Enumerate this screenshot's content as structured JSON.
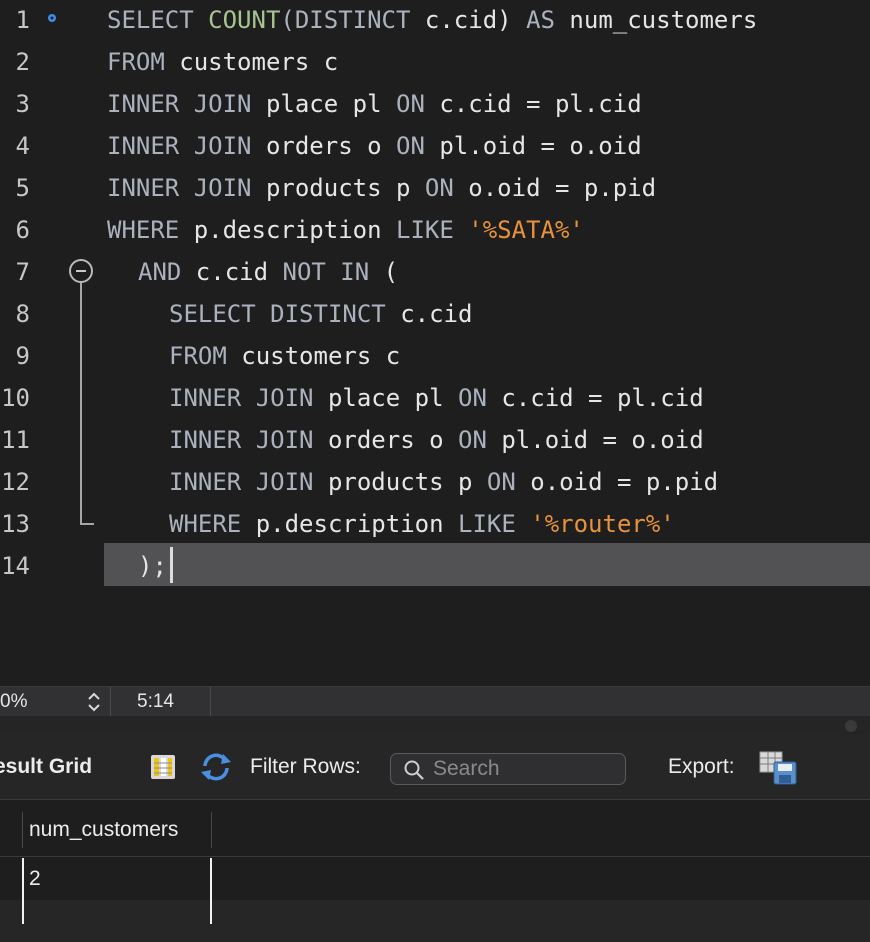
{
  "editor": {
    "colors": {
      "keyword": "#aab2bd",
      "function": "#a7c68f",
      "string": "#e8923c",
      "plain": "#e6e6e6"
    },
    "lines": [
      {
        "num": "1",
        "indent": 0,
        "tokens": [
          {
            "t": "SELECT ",
            "c": "keyword"
          },
          {
            "t": "COUNT",
            "c": "function"
          },
          {
            "t": "(DISTINCT ",
            "c": "keyword"
          },
          {
            "t": "c.cid) ",
            "c": "plain"
          },
          {
            "t": "AS ",
            "c": "keyword"
          },
          {
            "t": "num_customers",
            "c": "plain"
          }
        ]
      },
      {
        "num": "2",
        "indent": 0,
        "tokens": [
          {
            "t": "FROM ",
            "c": "keyword"
          },
          {
            "t": "customers c",
            "c": "plain"
          }
        ]
      },
      {
        "num": "3",
        "indent": 0,
        "tokens": [
          {
            "t": "INNER JOIN ",
            "c": "keyword"
          },
          {
            "t": "place pl ",
            "c": "plain"
          },
          {
            "t": "ON ",
            "c": "keyword"
          },
          {
            "t": "c.cid = pl.cid",
            "c": "plain"
          }
        ]
      },
      {
        "num": "4",
        "indent": 0,
        "tokens": [
          {
            "t": "INNER JOIN ",
            "c": "keyword"
          },
          {
            "t": "orders o ",
            "c": "plain"
          },
          {
            "t": "ON ",
            "c": "keyword"
          },
          {
            "t": "pl.oid = o.oid",
            "c": "plain"
          }
        ]
      },
      {
        "num": "5",
        "indent": 0,
        "tokens": [
          {
            "t": "INNER JOIN ",
            "c": "keyword"
          },
          {
            "t": "products p ",
            "c": "plain"
          },
          {
            "t": "ON ",
            "c": "keyword"
          },
          {
            "t": "o.oid = p.pid",
            "c": "plain"
          }
        ]
      },
      {
        "num": "6",
        "indent": 0,
        "tokens": [
          {
            "t": "WHERE ",
            "c": "keyword"
          },
          {
            "t": "p.description ",
            "c": "plain"
          },
          {
            "t": "LIKE ",
            "c": "keyword"
          },
          {
            "t": "'%SATA%'",
            "c": "string"
          }
        ]
      },
      {
        "num": "7",
        "indent": 1,
        "tokens": [
          {
            "t": "AND ",
            "c": "keyword"
          },
          {
            "t": "c.cid ",
            "c": "plain"
          },
          {
            "t": "NOT IN ",
            "c": "keyword"
          },
          {
            "t": "(",
            "c": "plain"
          }
        ]
      },
      {
        "num": "8",
        "indent": 2,
        "tokens": [
          {
            "t": "SELECT DISTINCT ",
            "c": "keyword"
          },
          {
            "t": "c.cid",
            "c": "plain"
          }
        ]
      },
      {
        "num": "9",
        "indent": 2,
        "tokens": [
          {
            "t": "FROM ",
            "c": "keyword"
          },
          {
            "t": "customers c",
            "c": "plain"
          }
        ]
      },
      {
        "num": "10",
        "indent": 2,
        "tokens": [
          {
            "t": "INNER JOIN ",
            "c": "keyword"
          },
          {
            "t": "place pl ",
            "c": "plain"
          },
          {
            "t": "ON ",
            "c": "keyword"
          },
          {
            "t": "c.cid = pl.cid",
            "c": "plain"
          }
        ]
      },
      {
        "num": "11",
        "indent": 2,
        "tokens": [
          {
            "t": "INNER JOIN ",
            "c": "keyword"
          },
          {
            "t": "orders o ",
            "c": "plain"
          },
          {
            "t": "ON ",
            "c": "keyword"
          },
          {
            "t": "pl.oid = o.oid",
            "c": "plain"
          }
        ]
      },
      {
        "num": "12",
        "indent": 2,
        "tokens": [
          {
            "t": "INNER JOIN ",
            "c": "keyword"
          },
          {
            "t": "products p ",
            "c": "plain"
          },
          {
            "t": "ON ",
            "c": "keyword"
          },
          {
            "t": "o.oid = p.pid",
            "c": "plain"
          }
        ]
      },
      {
        "num": "13",
        "indent": 2,
        "tokens": [
          {
            "t": "WHERE ",
            "c": "keyword"
          },
          {
            "t": "p.description ",
            "c": "plain"
          },
          {
            "t": "LIKE ",
            "c": "keyword"
          },
          {
            "t": "'%router%'",
            "c": "string"
          }
        ]
      },
      {
        "num": "14",
        "indent": 1,
        "tokens": [
          {
            "t": ");",
            "c": "plain"
          }
        ]
      }
    ]
  },
  "status_bar": {
    "zoom": "0%",
    "cursor_position": "5:14"
  },
  "result_toolbar": {
    "title": "esult Grid",
    "filter_label": "Filter Rows:",
    "search_placeholder": "Search",
    "export_label": "Export:",
    "icons": [
      "grid-columns-icon",
      "refresh-icon",
      "search-icon",
      "export-save-icon"
    ]
  },
  "result_grid": {
    "columns": [
      "num_customers"
    ],
    "rows": [
      [
        "2"
      ]
    ]
  }
}
